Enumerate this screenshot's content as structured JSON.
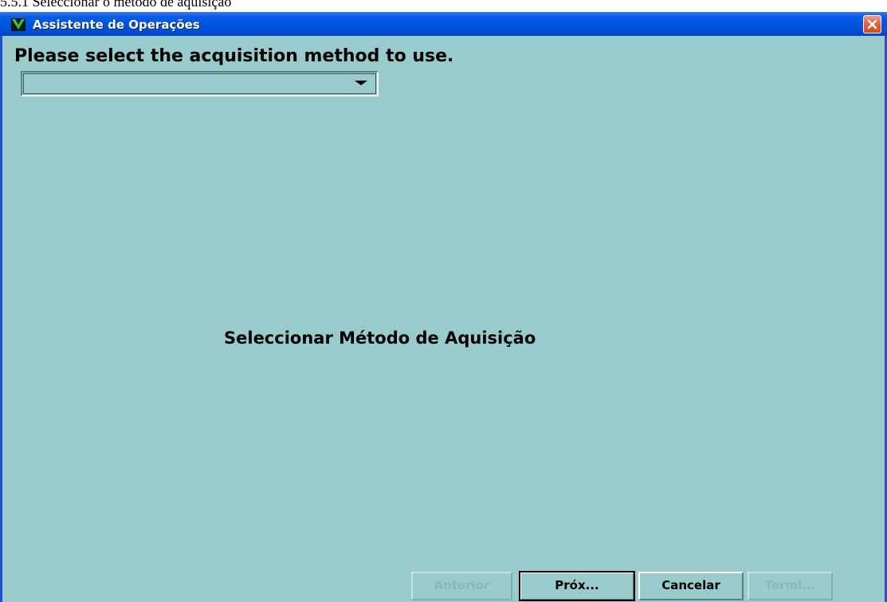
{
  "document": {
    "heading": "5.5.1 Seleccionar o método de aquisição"
  },
  "window": {
    "title": "Assistente de Operações",
    "icons": {
      "app": "app-logo-icon",
      "close": "close-icon"
    },
    "colors": {
      "titlebar": "#0054e3",
      "client_background": "#9acbcc",
      "close_button": "#e26742"
    }
  },
  "content": {
    "prompt": "Please select the acquisition method to use.",
    "method_select": {
      "value": "",
      "options": []
    },
    "center_title": "Seleccionar Método de Aquisição"
  },
  "buttons": {
    "previous": {
      "label": "Anterior",
      "enabled": false
    },
    "next": {
      "label": "Próx...",
      "enabled": true,
      "default": true
    },
    "cancel": {
      "label": "Cancelar",
      "enabled": true
    },
    "finish": {
      "label": "Termi...",
      "enabled": false
    }
  }
}
